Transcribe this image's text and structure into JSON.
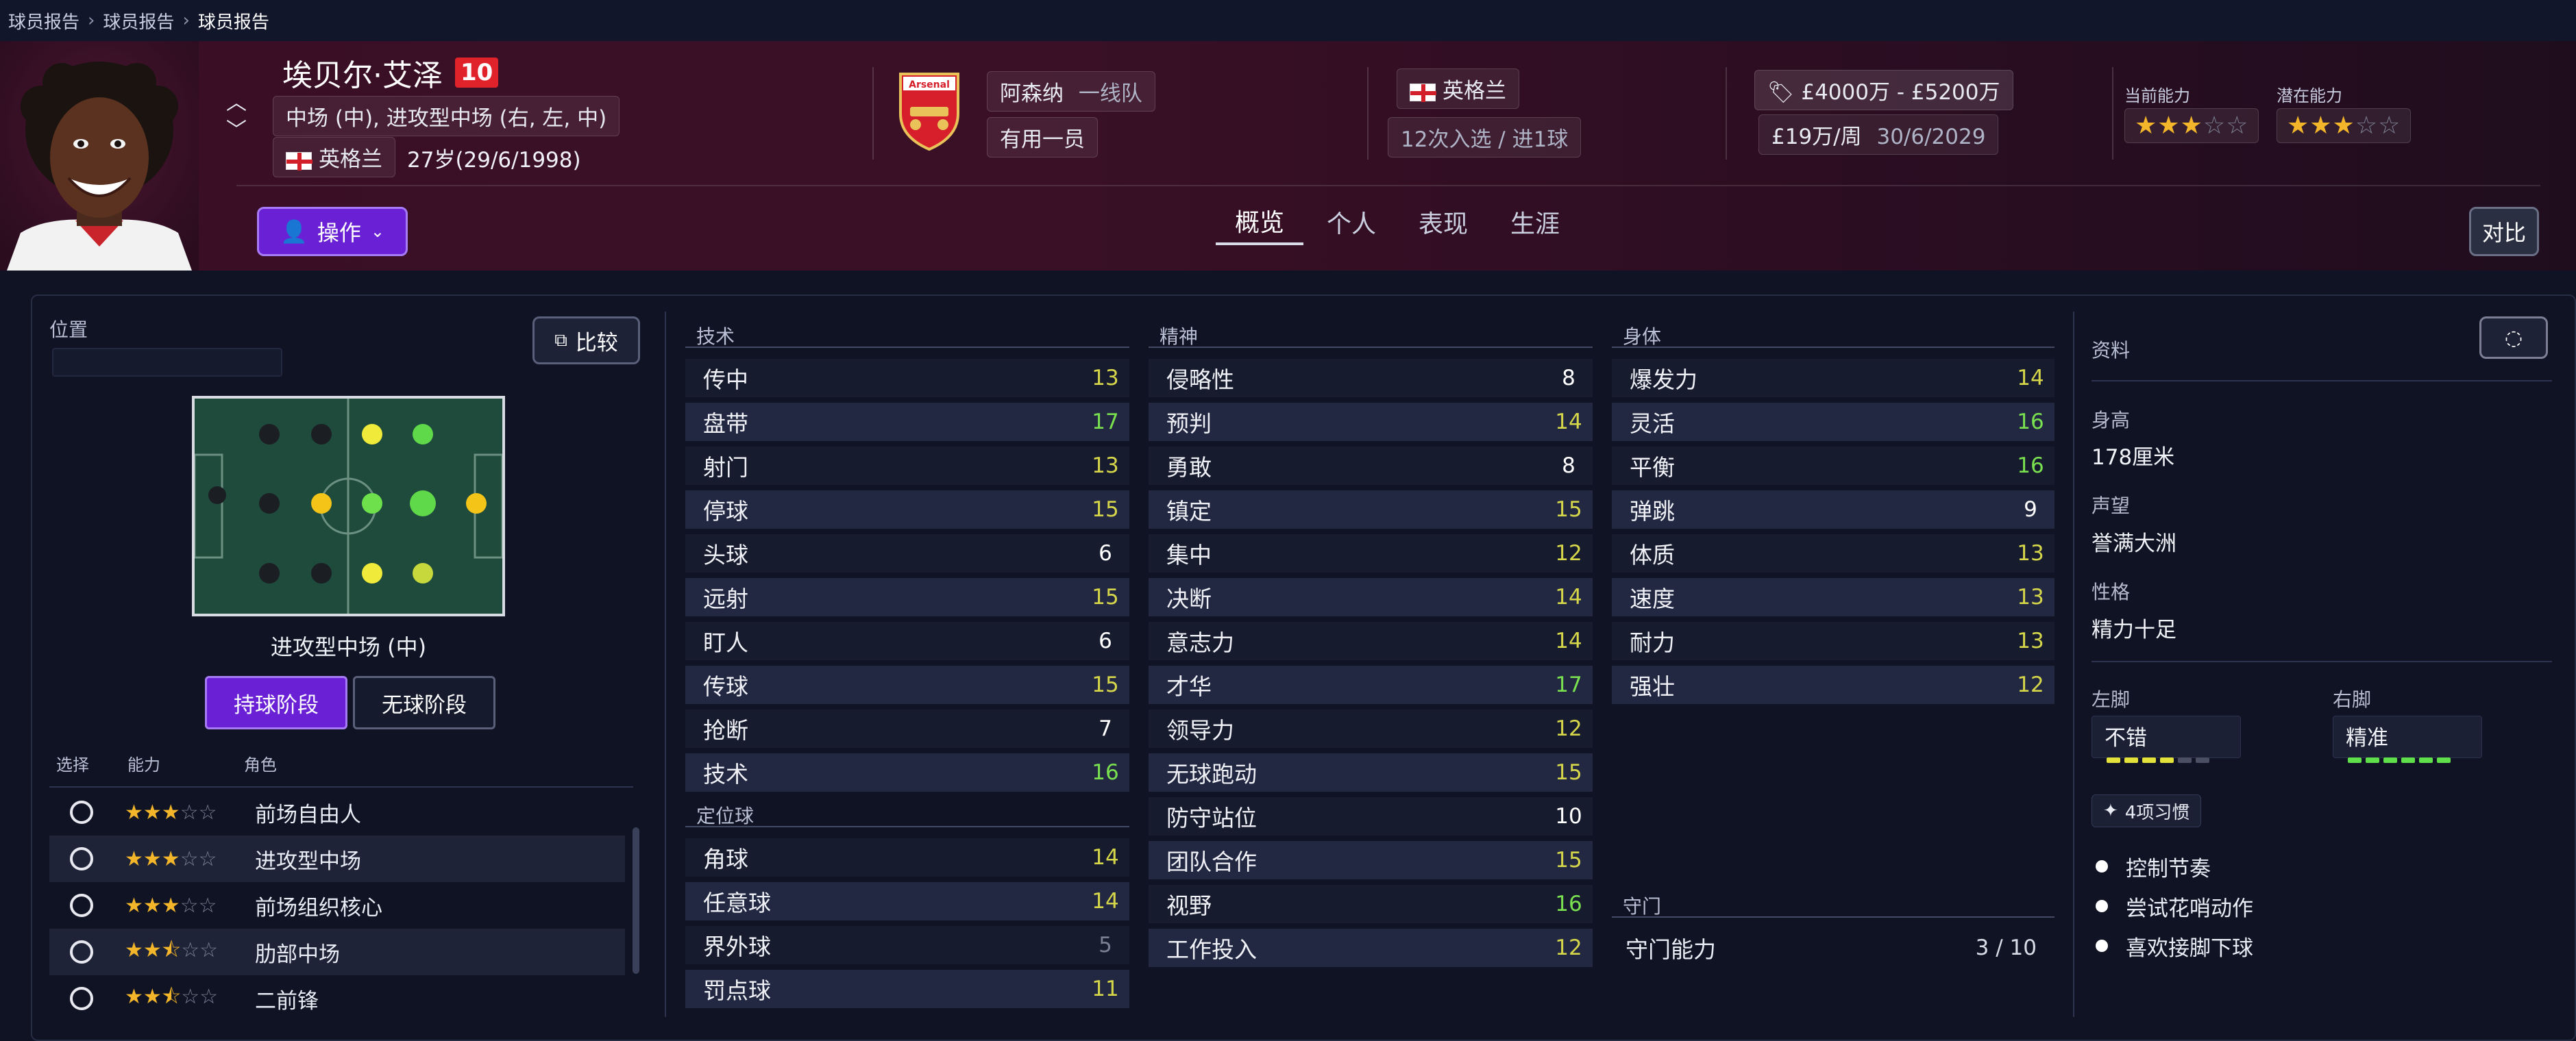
{
  "breadcrumb": [
    "球员报告",
    "球员报告",
    "球员报告"
  ],
  "player": {
    "name": "埃贝尔·艾泽",
    "number": "10",
    "positions": "中场 (中), 进攻型中场 (右, 左, 中)",
    "nationality": "英格兰",
    "age_dob": "27岁(29/6/1998)",
    "club": "阿森纳",
    "squad_status": "一线队",
    "role_status": "有用一员",
    "national_team": "英格兰",
    "caps_goals": "12次入选 / 进1球",
    "value": "£4000万 - £5200万",
    "wage": "£19万/周",
    "contract_end": "30/6/2029",
    "current_ability_label": "当前能力",
    "potential_ability_label": "潜在能力",
    "current_ability_stars": 3,
    "potential_ability_stars": 3
  },
  "action_button": "操作",
  "compare_top_button": "对比",
  "tabs": [
    "概览",
    "个人",
    "表现",
    "生涯"
  ],
  "active_tab": "概览",
  "position_panel": {
    "title": "位置",
    "compare_button": "比较",
    "position_label": "进攻型中场 (中)",
    "phase_in_possession": "持球阶段",
    "phase_out_possession": "无球阶段",
    "role_headers": [
      "选择",
      "能力",
      "角色"
    ],
    "roles": [
      {
        "name": "前场自由人",
        "stars": 3
      },
      {
        "name": "进攻型中场",
        "stars": 3
      },
      {
        "name": "前场组织核心",
        "stars": 3
      },
      {
        "name": "肋部中场",
        "stars": 2.5
      },
      {
        "name": "二前锋",
        "stars": 2.5
      }
    ]
  },
  "technical": {
    "title": "技术",
    "attrs": [
      {
        "name": "传中",
        "value": "13"
      },
      {
        "name": "盘带",
        "value": "17"
      },
      {
        "name": "射门",
        "value": "13"
      },
      {
        "name": "停球",
        "value": "15"
      },
      {
        "name": "头球",
        "value": "6"
      },
      {
        "name": "远射",
        "value": "15"
      },
      {
        "name": "盯人",
        "value": "6"
      },
      {
        "name": "传球",
        "value": "15"
      },
      {
        "name": "抢断",
        "value": "7"
      },
      {
        "name": "技术",
        "value": "16"
      }
    ]
  },
  "set_pieces": {
    "title": "定位球",
    "attrs": [
      {
        "name": "角球",
        "value": "14"
      },
      {
        "name": "任意球",
        "value": "14"
      },
      {
        "name": "界外球",
        "value": "5"
      },
      {
        "name": "罚点球",
        "value": "11"
      }
    ]
  },
  "mental": {
    "title": "精神",
    "attrs": [
      {
        "name": "侵略性",
        "value": "8"
      },
      {
        "name": "预判",
        "value": "14"
      },
      {
        "name": "勇敢",
        "value": "8"
      },
      {
        "name": "镇定",
        "value": "15"
      },
      {
        "name": "集中",
        "value": "12"
      },
      {
        "name": "决断",
        "value": "14"
      },
      {
        "name": "意志力",
        "value": "14"
      },
      {
        "name": "才华",
        "value": "17"
      },
      {
        "name": "领导力",
        "value": "12"
      },
      {
        "name": "无球跑动",
        "value": "15"
      },
      {
        "name": "防守站位",
        "value": "10"
      },
      {
        "name": "团队合作",
        "value": "15"
      },
      {
        "name": "视野",
        "value": "16"
      },
      {
        "name": "工作投入",
        "value": "12"
      }
    ]
  },
  "physical": {
    "title": "身体",
    "attrs": [
      {
        "name": "爆发力",
        "value": "14"
      },
      {
        "name": "灵活",
        "value": "16"
      },
      {
        "name": "平衡",
        "value": "16"
      },
      {
        "name": "弹跳",
        "value": "9"
      },
      {
        "name": "体质",
        "value": "13"
      },
      {
        "name": "速度",
        "value": "13"
      },
      {
        "name": "耐力",
        "value": "13"
      },
      {
        "name": "强壮",
        "value": "12"
      }
    ]
  },
  "goalkeeping": {
    "title": "守门",
    "name": "守门能力",
    "value": "3 / 10"
  },
  "info": {
    "title": "资料",
    "height_label": "身高",
    "height": "178厘米",
    "reputation_label": "声望",
    "reputation": "誉满大洲",
    "personality_label": "性格",
    "personality": "精力十足",
    "left_foot_label": "左脚",
    "left_foot": "不错",
    "right_foot_label": "右脚",
    "right_foot": "精准",
    "habits_button": "4项习惯",
    "habits": [
      "控制节奏",
      "尝试花哨动作",
      "喜欢接脚下球"
    ]
  },
  "colors": {
    "accent_purple": "#6a21d6",
    "header_bg": "#3a0f26",
    "value_green": "#79e04f",
    "value_yellow": "#d6d64a"
  }
}
